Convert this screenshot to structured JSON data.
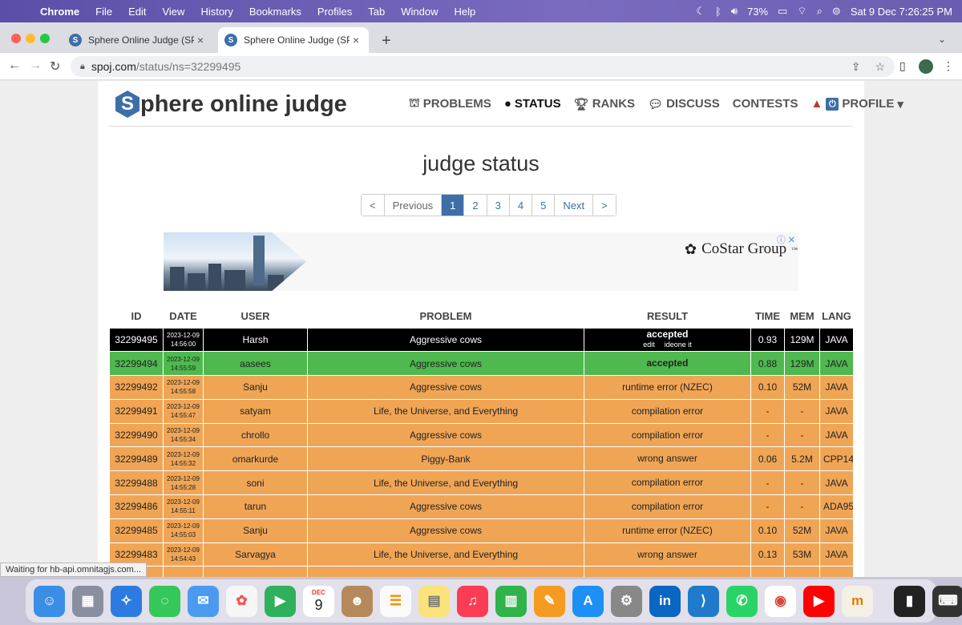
{
  "menubar": {
    "app_name": "Chrome",
    "menus": [
      "File",
      "Edit",
      "View",
      "History",
      "Bookmarks",
      "Profiles",
      "Tab",
      "Window",
      "Help"
    ],
    "battery": "73%",
    "datetime": "Sat 9 Dec  7:26:25 PM"
  },
  "tabs": [
    {
      "title": "Sphere Online Judge (SPOJ) -"
    },
    {
      "title": "Sphere Online Judge (SPOJ) -"
    }
  ],
  "address": {
    "host": "spoj.com",
    "path": "/status/ns=32299495"
  },
  "site": {
    "logo_initial": "S",
    "logo_text": "phere online judge",
    "nav": {
      "problems": "PROBLEMS",
      "status": "STATUS",
      "ranks": "RANKS",
      "discuss": "DISCUSS",
      "contests": "CONTESTS",
      "profile": "PROFILE"
    }
  },
  "page_title": "judge status",
  "pager": {
    "first": "<",
    "previous": "Previous",
    "pages": [
      "1",
      "2",
      "3",
      "4",
      "5"
    ],
    "next": "Next",
    "last": ">"
  },
  "ad": {
    "brand": "CoStar Group",
    "brand_mark": "™"
  },
  "table": {
    "headers": [
      "ID",
      "DATE",
      "USER",
      "PROBLEM",
      "RESULT",
      "TIME",
      "MEM",
      "LANG"
    ],
    "edit_label": "edit",
    "ideone_label": "ideone it",
    "rows": [
      {
        "id": "32299495",
        "date": "2023-12-09",
        "time_of_day": "14:56:00",
        "user": "Harsh",
        "problem": "Aggressive cows",
        "result": "accepted",
        "time": "0.93",
        "mem": "129M",
        "lang": "JAVA"
      },
      {
        "id": "32299494",
        "date": "2023-12-09",
        "time_of_day": "14:55:59",
        "user": "aasees",
        "problem": "Aggressive cows",
        "result": "accepted",
        "time": "0.88",
        "mem": "129M",
        "lang": "JAVA"
      },
      {
        "id": "32299492",
        "date": "2023-12-09",
        "time_of_day": "14:55:58",
        "user": "Sanju",
        "problem": "Aggressive cows",
        "result": "runtime error (NZEC)",
        "time": "0.10",
        "mem": "52M",
        "lang": "JAVA"
      },
      {
        "id": "32299491",
        "date": "2023-12-09",
        "time_of_day": "14:55:47",
        "user": "satyam",
        "problem": "Life, the Universe, and Everything",
        "result": "compilation error",
        "time": "-",
        "mem": "-",
        "lang": "JAVA"
      },
      {
        "id": "32299490",
        "date": "2023-12-09",
        "time_of_day": "14:55:34",
        "user": "chrollo",
        "problem": "Aggressive cows",
        "result": "compilation error",
        "time": "-",
        "mem": "-",
        "lang": "JAVA"
      },
      {
        "id": "32299489",
        "date": "2023-12-09",
        "time_of_day": "14:55:32",
        "user": "omarkurde",
        "problem": "Piggy-Bank",
        "result": "wrong answer",
        "time": "0.06",
        "mem": "5.2M",
        "lang": "CPP14"
      },
      {
        "id": "32299488",
        "date": "2023-12-09",
        "time_of_day": "14:55:28",
        "user": "soni",
        "problem": "Life, the Universe, and Everything",
        "result": "compilation error",
        "time": "-",
        "mem": "-",
        "lang": "JAVA"
      },
      {
        "id": "32299486",
        "date": "2023-12-09",
        "time_of_day": "14:55:11",
        "user": "tarun",
        "problem": "Aggressive cows",
        "result": "compilation error",
        "time": "-",
        "mem": "-",
        "lang": "ADA95"
      },
      {
        "id": "32299485",
        "date": "2023-12-09",
        "time_of_day": "14:55:03",
        "user": "Sanju",
        "problem": "Aggressive cows",
        "result": "runtime error (NZEC)",
        "time": "0.10",
        "mem": "52M",
        "lang": "JAVA"
      },
      {
        "id": "32299483",
        "date": "2023-12-09",
        "time_of_day": "14:54:43",
        "user": "Sarvagya",
        "problem": "Life, the Universe, and Everything",
        "result": "wrong answer",
        "time": "0.13",
        "mem": "53M",
        "lang": "JAVA"
      }
    ]
  },
  "status_bar": "Waiting for hb-api.omnitagjs.com...",
  "dock": {
    "calendar_month": "DEC",
    "calendar_day": "9"
  },
  "colors": {
    "accent": "#3d6ea8",
    "accepted_current": "#000000",
    "accepted": "#4fb84f",
    "error": "#f0a555"
  }
}
